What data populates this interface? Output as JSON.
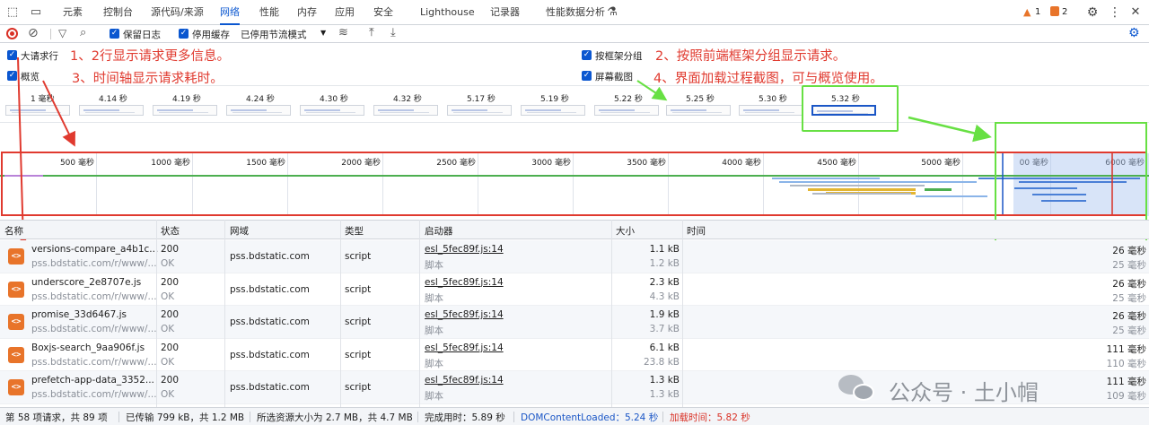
{
  "tabs": [
    "元素",
    "控制台",
    "源代码/来源",
    "网络",
    "性能",
    "内存",
    "应用",
    "安全",
    "Lighthouse",
    "记录器",
    "性能数据分析"
  ],
  "active_tab": "网络",
  "badges": {
    "warnings": "1",
    "issues": "2"
  },
  "toolbar": {
    "preserve_log": "保留日志",
    "disable_cache": "停用缓存",
    "throttle": "已停用节流模式"
  },
  "settings": {
    "big_rows": "大请求行",
    "overview": "概览",
    "group_by_frame": "按框架分组",
    "screenshots": "屏幕截图"
  },
  "annotations": {
    "a1": "1、2行显示请求更多信息。",
    "a2": "2、按照前端框架分组显示请求。",
    "a3": "3、时间轴显示请求耗时。",
    "a4": "4、界面加载过程截图，可与概览使用。"
  },
  "filmstrip": [
    "1 毫秒",
    "4.14 秒",
    "4.19 秒",
    "4.24 秒",
    "4.30 秒",
    "4.32 秒",
    "5.17 秒",
    "5.19 秒",
    "5.22 秒",
    "5.25 秒",
    "5.30 秒",
    "5.32 秒"
  ],
  "timeline_ticks": [
    "500 毫秒",
    "1000 毫秒",
    "1500 毫秒",
    "2000 毫秒",
    "2500 毫秒",
    "3000 毫秒",
    "3500 毫秒",
    "4000 毫秒",
    "4500 毫秒",
    "5000 毫秒",
    "00 毫秒",
    "6000 毫秒"
  ],
  "columns": [
    "名称",
    "状态",
    "网域",
    "类型",
    "启动器",
    "大小",
    "时间"
  ],
  "rows": [
    {
      "name": "versions-compare_a4b1c...",
      "path": "pss.bdstatic.com/r/www/...",
      "status": "200",
      "status_text": "OK",
      "domain": "pss.bdstatic.com",
      "type": "script",
      "initiator": "esl_5fec89f.js:14",
      "initiator_sub": "脚本",
      "size": "1.1 kB",
      "size2": "1.2 kB",
      "time": "26 毫秒",
      "time2": "25 毫秒"
    },
    {
      "name": "underscore_2e8707e.js",
      "path": "pss.bdstatic.com/r/www/...",
      "status": "200",
      "status_text": "OK",
      "domain": "pss.bdstatic.com",
      "type": "script",
      "initiator": "esl_5fec89f.js:14",
      "initiator_sub": "脚本",
      "size": "2.3 kB",
      "size2": "4.3 kB",
      "time": "26 毫秒",
      "time2": "25 毫秒"
    },
    {
      "name": "promise_33d6467.js",
      "path": "pss.bdstatic.com/r/www/...",
      "status": "200",
      "status_text": "OK",
      "domain": "pss.bdstatic.com",
      "type": "script",
      "initiator": "esl_5fec89f.js:14",
      "initiator_sub": "脚本",
      "size": "1.9 kB",
      "size2": "3.7 kB",
      "time": "26 毫秒",
      "time2": "25 毫秒"
    },
    {
      "name": "Boxjs-search_9aa906f.js",
      "path": "pss.bdstatic.com/r/www/...",
      "status": "200",
      "status_text": "OK",
      "domain": "pss.bdstatic.com",
      "type": "script",
      "initiator": "esl_5fec89f.js:14",
      "initiator_sub": "脚本",
      "size": "6.1 kB",
      "size2": "23.8 kB",
      "time": "111 毫秒",
      "time2": "110 毫秒"
    },
    {
      "name": "prefetch-app-data_3352...",
      "path": "pss.bdstatic.com/r/www/...",
      "status": "200",
      "status_text": "OK",
      "domain": "pss.bdstatic.com",
      "type": "script",
      "initiator": "esl_5fec89f.js:14",
      "initiator_sub": "脚本",
      "size": "1.3 kB",
      "size2": "1.3 kB",
      "time": "111 毫秒",
      "time2": "109 毫秒"
    }
  ],
  "status_bar": {
    "requests": "第 58 项请求，共 89 项",
    "transferred": "已传输 799 kB，共 1.2 MB",
    "resources": "所选资源大小为 2.7 MB，共 4.7 MB",
    "finish": "完成用时：5.89 秒",
    "dcl": "DOMContentLoaded：5.24 秒",
    "load": "加载时间：5.82 秒"
  },
  "watermark": "公众号 · 土小帽",
  "colors": {
    "accent": "#0b57d0",
    "annotation_red": "#e03a2f",
    "annotation_green": "#67e043",
    "dcl_blue": "#1a56c6",
    "load_red": "#d93025"
  }
}
